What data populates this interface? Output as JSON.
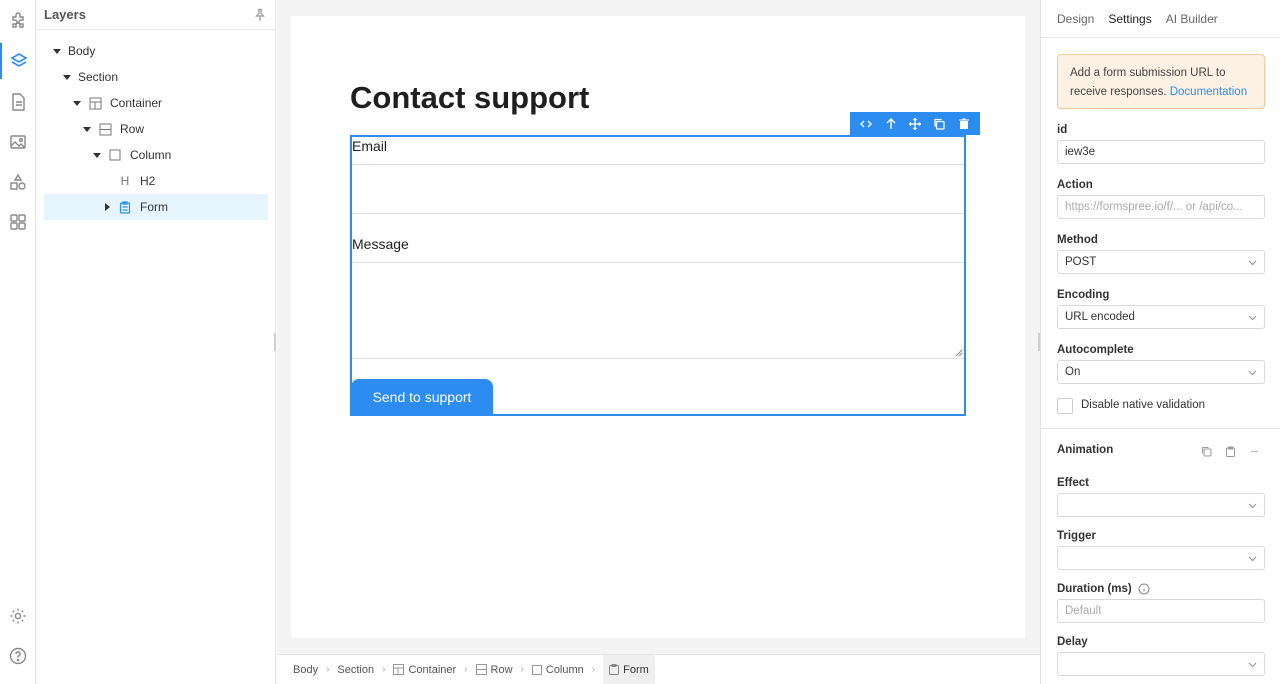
{
  "layers": {
    "title": "Layers",
    "tree": [
      {
        "label": "Body"
      },
      {
        "label": "Section"
      },
      {
        "label": "Container"
      },
      {
        "label": "Row"
      },
      {
        "label": "Column"
      },
      {
        "label": "H2"
      },
      {
        "label": "Form"
      }
    ]
  },
  "canvas": {
    "heading": "Contact support",
    "email_label": "Email",
    "message_label": "Message",
    "submit_label": "Send to support"
  },
  "breadcrumb": [
    "Body",
    "Section",
    "Container",
    "Row",
    "Column",
    "Form"
  ],
  "settings": {
    "tabs": [
      "Design",
      "Settings",
      "AI Builder"
    ],
    "active_tab": "Settings",
    "notice_text": "Add a form submission URL to receive responses.",
    "notice_link": "Documentation",
    "id_label": "id",
    "id_value": "iew3e",
    "action_label": "Action",
    "action_placeholder": "https://formspree.io/f/... or /api/co...",
    "method_label": "Method",
    "method_value": "POST",
    "encoding_label": "Encoding",
    "encoding_value": "URL encoded",
    "autocomplete_label": "Autocomplete",
    "autocomplete_value": "On",
    "disable_validation_label": "Disable native validation",
    "animation_title": "Animation",
    "effect_label": "Effect",
    "trigger_label": "Trigger",
    "duration_label": "Duration (ms)",
    "duration_placeholder": "Default",
    "delay_label": "Delay"
  },
  "colors": {
    "accent": "#2d8cf0",
    "selected_row": "#e6f4fd",
    "notice_bg": "#fdf1e3"
  }
}
